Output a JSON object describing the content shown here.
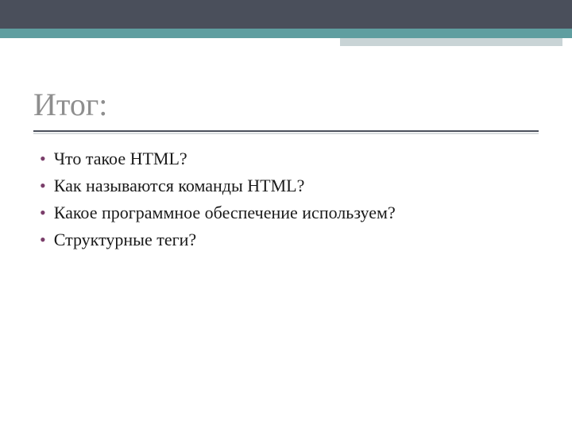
{
  "title": "Итог:",
  "bullets": [
    "Что такое HTML?",
    "Как называются команды HTML?",
    "Какое программное обеспечение используем?",
    "Структурные теги?"
  ],
  "colors": {
    "topbar_dark": "#4a4f5b",
    "topbar_teal": "#5f9ea0",
    "accent_light": "#c9d4d6",
    "title_gray": "#8e8e8e",
    "bullet_marker": "#7a3e6a"
  }
}
